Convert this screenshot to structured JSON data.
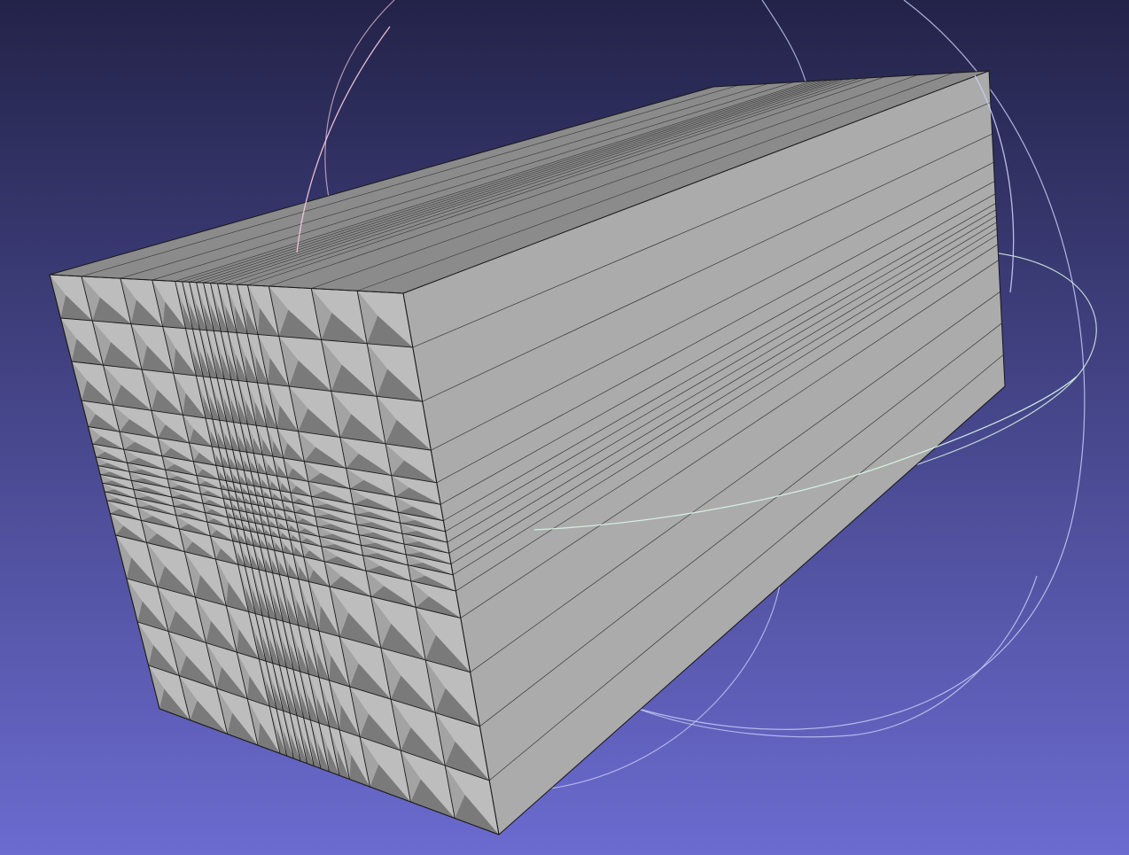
{
  "viewport": {
    "background_top": "#232349",
    "background_bottom": "#6b6bd0",
    "trackball_ring_x_color": "#f1c6da",
    "trackball_ring_y_color": "#c8cdf4",
    "trackball_ring_z_color": "#d6f2e4"
  },
  "mesh": {
    "front_face_color": "#a3a3a3",
    "side_face_color": "#ababab",
    "top_face_color": "#8b8b8b",
    "cell_shadow_color": "#7a7a7a",
    "cell_light_color": "#bdbdbd",
    "edge_color": "#1a1a1a"
  }
}
